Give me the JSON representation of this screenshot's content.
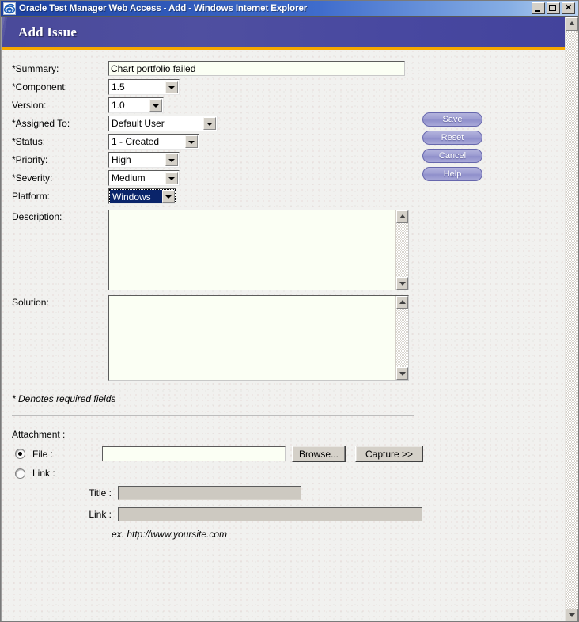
{
  "window": {
    "title": "Oracle Test Manager Web Access - Add - Windows Internet Explorer",
    "app_icon": "internet-explorer-icon",
    "controls": {
      "minimize": "minimize-icon",
      "maximize": "maximize-icon",
      "close": "✕"
    }
  },
  "banner": {
    "title": "Add Issue",
    "bg_color": "#4e4e9e",
    "accent_color": "#f5a800"
  },
  "form": {
    "summary": {
      "label": "*Summary:",
      "value": "Chart portfolio failed",
      "placeholder": ""
    },
    "component": {
      "label": "*Component:",
      "value": "1.5"
    },
    "version": {
      "label": "Version:",
      "value": "1.0"
    },
    "assigned_to": {
      "label": "*Assigned To:",
      "value": "Default User"
    },
    "status": {
      "label": "*Status:",
      "value": "1 - Created"
    },
    "priority": {
      "label": "*Priority:",
      "value": "High"
    },
    "severity": {
      "label": "*Severity:",
      "value": "Medium"
    },
    "platform": {
      "label": "Platform:",
      "value": "Windows",
      "focused": true
    },
    "description": {
      "label": "Description:",
      "value": "",
      "placeholder": ""
    },
    "solution": {
      "label": "Solution:",
      "value": "",
      "placeholder": ""
    },
    "required_note": "* Denotes required fields"
  },
  "actions": {
    "save": "Save",
    "reset": "Reset",
    "cancel": "Cancel",
    "help": "Help",
    "color": "#9d9dd2"
  },
  "attachment": {
    "title": "Attachment :",
    "file_radio_label": "File :",
    "link_radio_label": "Link :",
    "file_value": "",
    "file_placeholder": "",
    "browse_button": "Browse...",
    "capture_button": "Capture >>",
    "title_label": "Title :",
    "title_value": "",
    "link_label": "Link :",
    "link_value": "",
    "example_hint": "ex. http://www.yoursite.com"
  },
  "scrollbars": {
    "up_arrow": "scroll-up-icon",
    "down_arrow": "scroll-down-icon"
  }
}
